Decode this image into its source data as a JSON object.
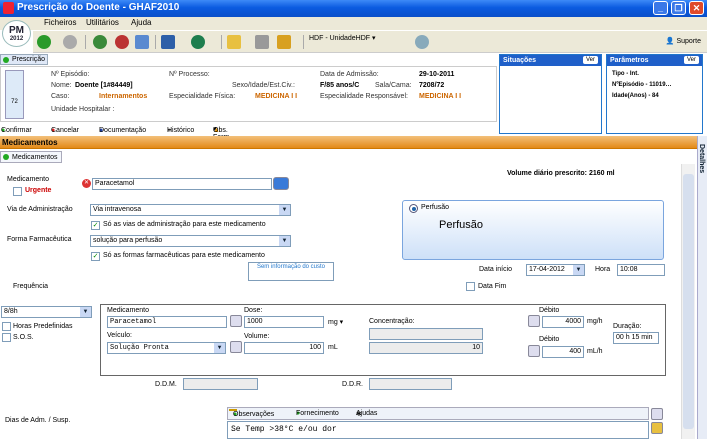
{
  "window": {
    "title": "Prescrição do Doente - GHAF2010",
    "minimize": "_",
    "maximize": "❐",
    "close": "✕"
  },
  "menu": {
    "items": [
      "Ficheiros",
      "Utilitários",
      "Ajuda"
    ]
  },
  "logo": {
    "line1": "PM",
    "line2": "2012"
  },
  "toolbar": {
    "hdf_label": "HDF - UnidadeHDF",
    "suporte": "Suporte"
  },
  "prescricao_tab": "Prescrição",
  "patient": {
    "episodio_label": "Nº Episódio:",
    "episodio_value": "",
    "nome_label": "Nome:",
    "nome_value": "Doente [1#84449]",
    "caso_label": "Caso:",
    "caso_value": "Internamentos",
    "unidade_label": "Unidade Hospitalar :",
    "processo_label": "Nº Processo:",
    "sexo_label": "Sexo/Idade/Est.Civ.:",
    "sexo_value": "F/85 anos/C",
    "esp_fisica_label": "Especialidade Física:",
    "esp_fisica_value": "MEDICINA I I",
    "admissao_label": "Data de Admissão:",
    "admissao_value": "29-10-2011",
    "sala_label": "Sala/Cama:",
    "sala_value": "7208/72",
    "esp_resp_label": "Especialidade Responsável:",
    "esp_resp_value": "MEDICINA I I",
    "bed_number": "72"
  },
  "situacoes": {
    "title": "Situações",
    "ver": "Ver"
  },
  "parametros": {
    "title": "Parâmetros",
    "ver": "Ver",
    "lines": [
      "Tipo - Int.",
      "NºEpisódio - 11019…",
      "Idade(Anos) - 84"
    ]
  },
  "actions": {
    "confirmar": "Confirmar",
    "cancelar": "Cancelar",
    "documentacao": "Documentação",
    "historico": "Histórico",
    "obs_farm": "Obs. Farm"
  },
  "medicamentos_bar": "Medicamentos",
  "medicamentos_tab": "Medicamentos",
  "detalhes": "Detalhes",
  "form": {
    "medicamento_label": "Medicamento",
    "urgente_label": "Urgente",
    "medicamento_value": "Paracetamol",
    "volume_diario": "Volume diário prescrito: 2160 ml",
    "via_label": "Via de Administração",
    "via_value": "Via intravenosa",
    "so_vias_label": "Só as vias de administração para este medicamento",
    "forma_label": "Forma Farmacêutica",
    "forma_value": "solução para perfusão",
    "so_formas_label": "Só as formas farmacêuticas para este medicamento",
    "sem_info_custo": "Sem informação do custo",
    "frequencia_label": "Frequência",
    "frequencia_value": "8/8h",
    "horas_predef_label": "Horas Predefinidas",
    "sos_label": "S.O.S.",
    "perfusao_radio": "Perfusão",
    "perfusao_title": "Perfusão",
    "data_inicio_label": "Data início",
    "data_inicio_value": "17-04-2012",
    "hora_label": "Hora",
    "hora_value": "10:08",
    "data_fim_label": "Data Fim"
  },
  "medbox": {
    "medicamento_label": "Medicamento",
    "medicamento_value": "Paracetamol",
    "dose_label": "Dose:",
    "dose_value": "1000",
    "dose_unit": "mg",
    "concentracao_label": "Concentração:",
    "concentracao_value": "10",
    "debito1_label": "Débito",
    "debito1_value": "4000",
    "debito1_unit": "mg/h",
    "veiculo_label": "Veículo:",
    "veiculo_value": "Solução Pronta",
    "volume_label": "Volume:",
    "volume_value": "100",
    "volume_unit": "mL",
    "debito2_label": "Débito",
    "debito2_value": "400",
    "debito2_unit": "mL/h",
    "duracao_label": "Duração:",
    "duracao_value": "00 h 15 min"
  },
  "ddm_label": "D.D.M.",
  "ddr_label": "D.D.R.",
  "dias_adm_label": "Dias de Adm. / Susp.",
  "bottom_tabs": {
    "observacoes": "Observações",
    "fornecimento": "Fornecimento",
    "ajudas": "Ajudas"
  },
  "observacao_text": "Se Temp >38°C e/ou dor"
}
